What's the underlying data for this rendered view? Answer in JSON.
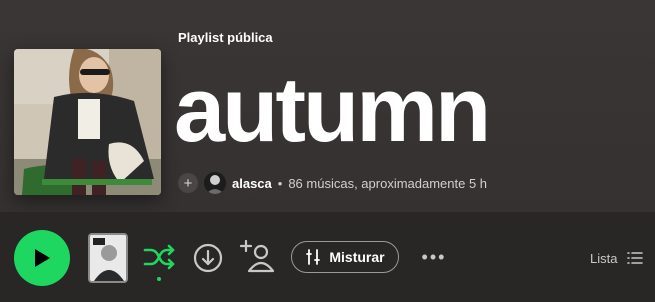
{
  "playlist": {
    "type_label": "Playlist pública",
    "title": "autumn",
    "owner": "alasca",
    "separator": "•",
    "summary": "86 músicas, aproximadamente 5 h"
  },
  "controls": {
    "mix_label": "Misturar",
    "more_label": "•••",
    "view_label": "Lista"
  },
  "colors": {
    "accent": "#1ed760",
    "background": "#2a2727"
  },
  "icons": {
    "play": "play-icon",
    "shuffle": "shuffle-icon",
    "download": "download-icon",
    "add_user": "add-user-icon",
    "mix": "sliders-icon",
    "list": "list-icon",
    "add": "plus-icon"
  }
}
